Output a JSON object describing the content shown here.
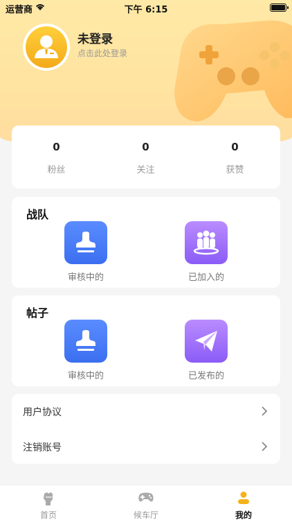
{
  "status_bar": {
    "carrier": "运营商",
    "time": "下午 6:15"
  },
  "profile": {
    "name": "未登录",
    "hint": "点击此处登录"
  },
  "stats": [
    {
      "value": "0",
      "label": "粉丝"
    },
    {
      "value": "0",
      "label": "关注"
    },
    {
      "value": "0",
      "label": "获赞"
    }
  ],
  "team": {
    "title": "战队",
    "items": [
      {
        "label": "审核中的",
        "icon": "stamp-icon"
      },
      {
        "label": "已加入的",
        "icon": "group-icon"
      }
    ]
  },
  "posts": {
    "title": "帖子",
    "items": [
      {
        "label": "审核中的",
        "icon": "stamp-icon"
      },
      {
        "label": "已发布的",
        "icon": "paper-plane-icon"
      }
    ]
  },
  "menu": [
    {
      "label": "用户协议"
    },
    {
      "label": "注销账号"
    }
  ],
  "tabs": [
    {
      "label": "首页",
      "icon": "fist-icon"
    },
    {
      "label": "候车厅",
      "icon": "gamepad-icon"
    },
    {
      "label": "我的",
      "icon": "person-icon"
    }
  ],
  "colors": {
    "accent": "#f5b21c",
    "blue_tile": "#4a7ef6",
    "purple_tile": "#a374fb",
    "hero_bg": "#ffe6a3"
  }
}
